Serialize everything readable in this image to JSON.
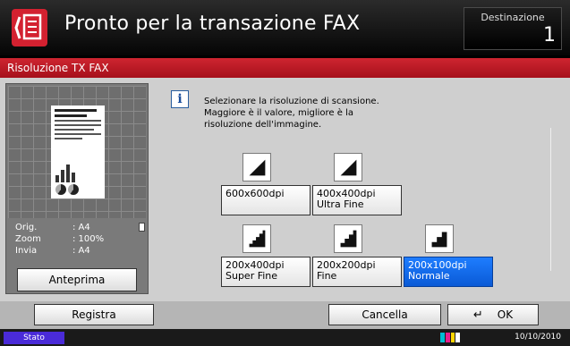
{
  "header": {
    "title": "Pronto per la transazione FAX",
    "destination_label": "Destinazione",
    "destination_count": "1"
  },
  "screen": {
    "title": "Risoluzione TX FAX"
  },
  "preview": {
    "info": [
      {
        "label": "Orig.",
        "value": ": A4"
      },
      {
        "label": "Zoom",
        "value": ": 100%"
      },
      {
        "label": "Invia",
        "value": ": A4"
      }
    ],
    "preview_button": "Anteprima"
  },
  "message": "Selezionare la risoluzione di scansione.\nMaggiore è il valore, migliore è la\nrisoluzione dell'immagine.",
  "options": [
    {
      "line1": "600x600dpi",
      "line2": "",
      "selected": false
    },
    {
      "line1": "400x400dpi",
      "line2": "Ultra Fine",
      "selected": false
    },
    {
      "line1": "200x400dpi",
      "line2": "Super Fine",
      "selected": false
    },
    {
      "line1": "200x200dpi",
      "line2": "Fine",
      "selected": false
    },
    {
      "line1": "200x100dpi",
      "line2": "Normale",
      "selected": true
    }
  ],
  "footer": {
    "register": "Registra",
    "cancel": "Cancella",
    "ok": "OK"
  },
  "status": {
    "label": "Stato",
    "date": "10/10/2010"
  },
  "colors": {
    "accent_red": "#c41a24",
    "selected_blue": "#1e7dff",
    "status_purple": "#4a2bd8"
  }
}
